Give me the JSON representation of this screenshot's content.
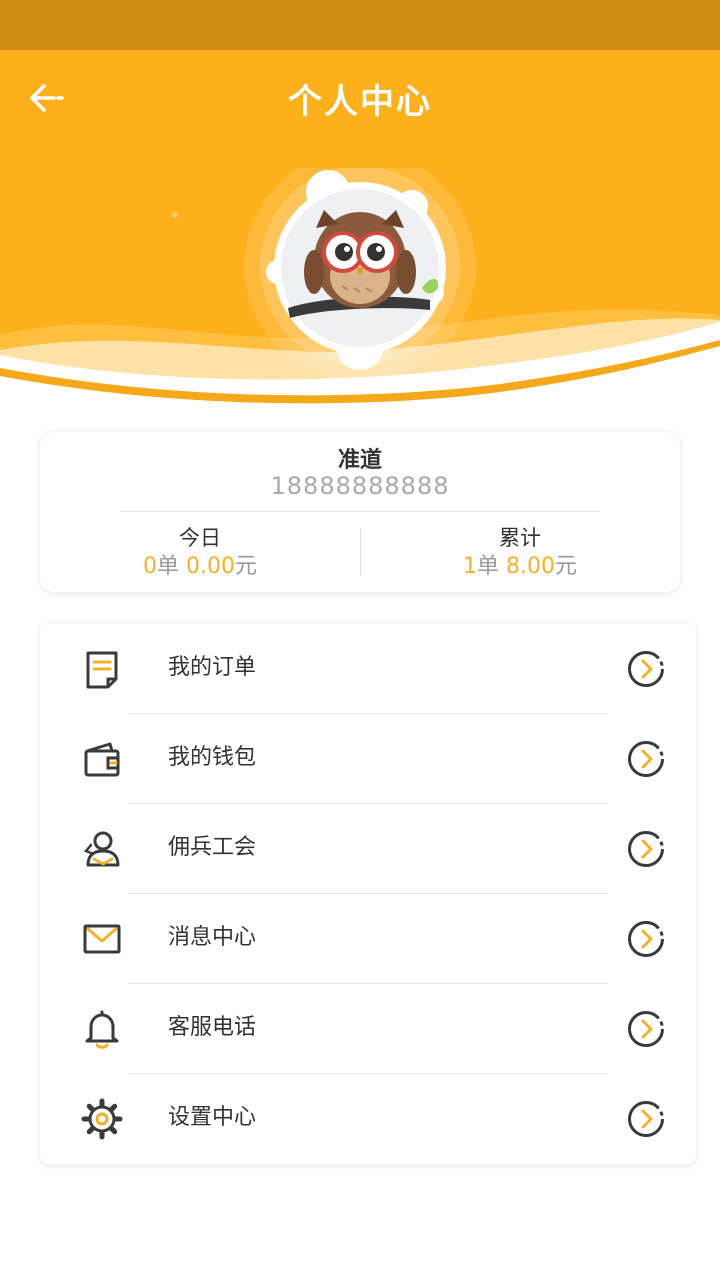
{
  "header": {
    "title": "个人中心",
    "back_icon": "arrow-left-icon",
    "colors": {
      "status_bar": "#cf8d14",
      "header": "#fdb01c",
      "accent": "#f3b02b"
    }
  },
  "profile": {
    "avatar": "owl-avatar",
    "name": "准道",
    "phone": "18888888888"
  },
  "stats": {
    "today": {
      "label": "今日",
      "orders": "0",
      "orders_unit": "单",
      "amount": "0.00",
      "amount_unit": "元"
    },
    "total": {
      "label": "累计",
      "orders": "1",
      "orders_unit": "单",
      "amount": "8.00",
      "amount_unit": "元"
    }
  },
  "menu": [
    {
      "label": "我的订单",
      "icon": "order-note-icon"
    },
    {
      "label": "我的钱包",
      "icon": "wallet-icon"
    },
    {
      "label": "佣兵工会",
      "icon": "guild-user-icon"
    },
    {
      "label": "消息中心",
      "icon": "mail-icon"
    },
    {
      "label": "客服电话",
      "icon": "bell-icon"
    },
    {
      "label": "设置中心",
      "icon": "gear-icon"
    }
  ]
}
